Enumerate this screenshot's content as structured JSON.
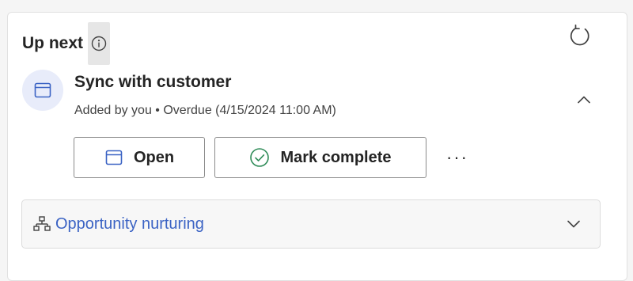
{
  "up_next": {
    "title": "Up next",
    "info_icon": "info-icon",
    "refresh_icon": "refresh-icon"
  },
  "activity": {
    "icon": "calendar-icon",
    "title": "Sync with customer",
    "meta": "Added by you • Overdue (4/15/2024 11:00 AM)",
    "collapse_icon": "chevron-up-icon",
    "open_label": "Open",
    "mark_complete_label": "Mark complete",
    "more_label": "···"
  },
  "sequence": {
    "icon": "hierarchy-icon",
    "label": "Opportunity nurturing",
    "expand_icon": "chevron-down-icon"
  },
  "colors": {
    "accent": "#3b63c4",
    "icon_circle_bg": "#e8ecfa",
    "check_green": "#2e8b57"
  }
}
